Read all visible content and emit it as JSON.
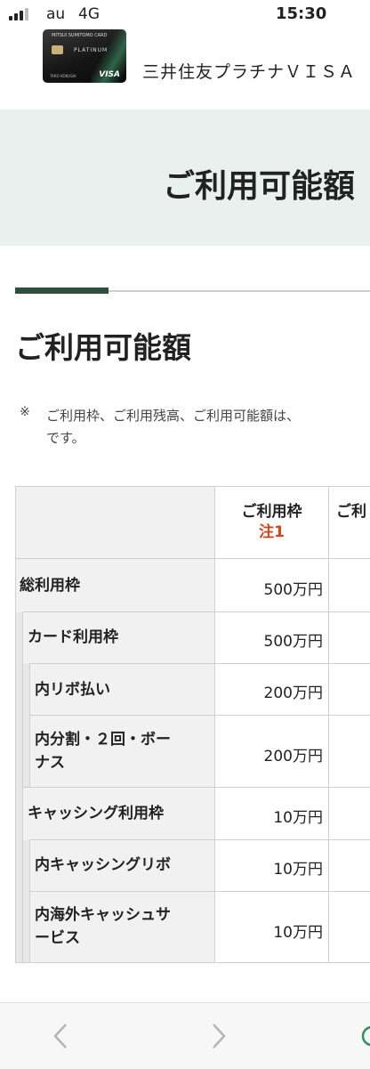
{
  "status_bar": {
    "carrier": "au",
    "network": "4G",
    "time": "15:30"
  },
  "app_header": {
    "title": "三井住友プラチナＶＩＳＡ",
    "card": {
      "brand": "MITSUI SUMITOMO CARD",
      "series": "PLATINUM",
      "network": "VISA",
      "holder": "TARO KOKUSAI"
    }
  },
  "banner": {
    "title": "ご利用可能額"
  },
  "section": {
    "heading": "ご利用可能額",
    "note_mark": "※",
    "note_lines": [
      "ご利用枠、ご利用残高、ご利用可能額は、",
      "です。"
    ]
  },
  "table": {
    "columns": [
      {
        "label": "ご利用枠",
        "note": "注1"
      },
      {
        "label": "ご利"
      }
    ],
    "rows": [
      {
        "label": "総利用枠",
        "limit": "500万円"
      },
      {
        "label": "カード利用枠",
        "limit": "500万円"
      },
      {
        "label": "内リボ払い",
        "limit": "200万円"
      },
      {
        "label_lines": [
          "内分割・２回・ボー",
          "ナス"
        ],
        "limit": "200万円"
      },
      {
        "label": "キャッシング利用枠",
        "limit": "10万円"
      },
      {
        "label": "内キャッシングリボ",
        "limit": "10万円"
      },
      {
        "label_lines": [
          "内海外キャッシュサ",
          "ービス"
        ],
        "limit": "10万円"
      }
    ]
  },
  "browser_nav": {
    "back_icon": "chevron-left-icon",
    "forward_icon": "chevron-right-icon",
    "accent": "#2f8f5e"
  }
}
